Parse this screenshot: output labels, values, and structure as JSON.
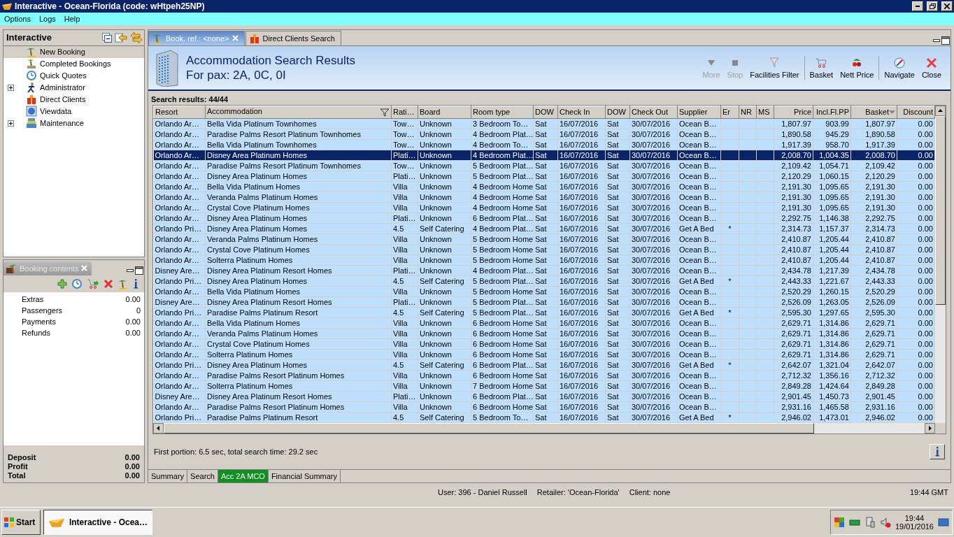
{
  "window": {
    "title": "Interactive - Ocean-Florida (code: wHtpeh25NP)"
  },
  "menu": [
    "Options",
    "Logs",
    "Help"
  ],
  "navigator": {
    "title": "Interactive",
    "items": [
      {
        "label": "New Booking",
        "selected": true,
        "kind": "leaf"
      },
      {
        "label": "Completed Bookings",
        "selected": false,
        "kind": "leaf"
      },
      {
        "label": "Quick Quotes",
        "selected": false,
        "kind": "leaf"
      },
      {
        "label": "Administrator",
        "selected": false,
        "kind": "folder",
        "expanded": false
      },
      {
        "label": "Direct Clients",
        "selected": false,
        "kind": "leaf"
      },
      {
        "label": "Viewdata",
        "selected": false,
        "kind": "leaf"
      },
      {
        "label": "Maintenance",
        "selected": false,
        "kind": "folder",
        "expanded": false
      }
    ]
  },
  "booking_contents": {
    "title": "Booking contents",
    "lines": [
      {
        "label": "Extras",
        "value": "0.00"
      },
      {
        "label": "Passengers",
        "value": "0"
      },
      {
        "label": "Payments",
        "value": "0.00"
      },
      {
        "label": "Refunds",
        "value": "0.00"
      }
    ],
    "totals": [
      {
        "label": "Deposit",
        "value": "0.00"
      },
      {
        "label": "Profit",
        "value": "0.00"
      },
      {
        "label": "Total",
        "value": "0.00"
      }
    ]
  },
  "tabs": [
    {
      "label": "Book. ref.: <none>",
      "selected": true,
      "closable": true
    },
    {
      "label": "Direct Clients Search",
      "selected": false,
      "closable": false
    }
  ],
  "header": {
    "title": "Accommodation Search Results",
    "subtitle": "For pax: 2A, 0C, 0I"
  },
  "toolbar": [
    {
      "label": "More",
      "disabled": true,
      "separator_before": false
    },
    {
      "label": "Stop",
      "disabled": true,
      "separator_before": false
    },
    {
      "label": "Facilities Filter",
      "disabled": false,
      "separator_before": false
    },
    {
      "label": "Basket",
      "disabled": false,
      "separator_before": true
    },
    {
      "label": "Nett Price",
      "disabled": false,
      "separator_before": false
    },
    {
      "label": "Navigate",
      "disabled": false,
      "separator_before": true
    },
    {
      "label": "Close",
      "disabled": false,
      "separator_before": false
    }
  ],
  "results_count": "Search results: 44/44",
  "table": {
    "columns": [
      "Resort",
      "Accommodation",
      "Rati…",
      "Board",
      "Room type",
      "DOW",
      "Check In",
      "DOW",
      "Check Out",
      "Supplier",
      "Er",
      "NR",
      "MS",
      "Price",
      "Incl.Fl.PP",
      "Basket",
      "Discount"
    ],
    "rows": [
      {
        "selected": false,
        "cells": {
          "0": "Orlando Ar…",
          "1": "Bella Vida Platinum Townhomes",
          "2": "Tow…",
          "3": "Unknown",
          "4": "3 Bedroom To…",
          "5": "Sat",
          "6": "16/07/2016",
          "7": "Sat",
          "8": "30/07/2016",
          "9": "Ocean B…",
          "13": "1,807.97",
          "14": "903.99",
          "15": "1,807.97",
          "16": "0.00"
        }
      },
      {
        "selected": false,
        "cells": {
          "0": "Orlando Ar…",
          "1": "Paradise Palms Resort Platinum Townhomes",
          "2": "Tow…",
          "3": "Unknown",
          "4": "4 Bedroom Plat…",
          "5": "Sat",
          "6": "16/07/2016",
          "7": "Sat",
          "8": "30/07/2016",
          "9": "Ocean B…",
          "13": "1,890.58",
          "14": "945.29",
          "15": "1,890.58",
          "16": "0.00"
        }
      },
      {
        "selected": false,
        "cells": {
          "0": "Orlando Ar…",
          "1": "Bella Vida Platinum Townhomes",
          "2": "Tow…",
          "3": "Unknown",
          "4": "4 Bedroom To…",
          "5": "Sat",
          "6": "16/07/2016",
          "7": "Sat",
          "8": "30/07/2016",
          "9": "Ocean B…",
          "13": "1,917.39",
          "14": "958.70",
          "15": "1,917.39",
          "16": "0.00"
        }
      },
      {
        "selected": true,
        "cells": {
          "0": "Orlando Ar…",
          "1": "Disney Area Platinum Homes",
          "2": "Plati…",
          "3": "Unknown",
          "4": "4 Bedroom Plat…",
          "5": "Sat",
          "6": "16/07/2016",
          "7": "Sat",
          "8": "30/07/2016",
          "9": "Ocean B…",
          "13": "2,008.70",
          "14": "1,004.35",
          "15": "2,008.70",
          "16": "0.00"
        }
      },
      {
        "selected": false,
        "cells": {
          "0": "Orlando Ar…",
          "1": "Paradise Palms Resort Platinum Townhomes",
          "2": "Tow…",
          "3": "Unknown",
          "4": "5 Bedroom Plat…",
          "5": "Sat",
          "6": "16/07/2016",
          "7": "Sat",
          "8": "30/07/2016",
          "9": "Ocean B…",
          "13": "2,109.42",
          "14": "1,054.71",
          "15": "2,109.42",
          "16": "0.00"
        }
      },
      {
        "selected": false,
        "cells": {
          "0": "Orlando Ar…",
          "1": "Disney Area Platinum Homes",
          "2": "Plati…",
          "3": "Unknown",
          "4": "5 Bedroom Plat…",
          "5": "Sat",
          "6": "16/07/2016",
          "7": "Sat",
          "8": "30/07/2016",
          "9": "Ocean B…",
          "13": "2,120.29",
          "14": "1,060.15",
          "15": "2,120.29",
          "16": "0.00"
        }
      },
      {
        "selected": false,
        "cells": {
          "0": "Orlando Ar…",
          "1": "Bella Vida Platinum Homes",
          "2": "Villa",
          "3": "Unknown",
          "4": "4 Bedroom Home",
          "5": "Sat",
          "6": "16/07/2016",
          "7": "Sat",
          "8": "30/07/2016",
          "9": "Ocean B…",
          "13": "2,191.30",
          "14": "1,095.65",
          "15": "2,191.30",
          "16": "0.00"
        }
      },
      {
        "selected": false,
        "cells": {
          "0": "Orlando Ar…",
          "1": "Veranda Palms Platinum Homes",
          "2": "Villa",
          "3": "Unknown",
          "4": "4 Bedroom Home",
          "5": "Sat",
          "6": "16/07/2016",
          "7": "Sat",
          "8": "30/07/2016",
          "9": "Ocean B…",
          "13": "2,191.30",
          "14": "1,095.65",
          "15": "2,191.30",
          "16": "0.00"
        }
      },
      {
        "selected": false,
        "cells": {
          "0": "Orlando Ar…",
          "1": "Crystal Cove Platinum Homes",
          "2": "Villa",
          "3": "Unknown",
          "4": "4 Bedroom Home",
          "5": "Sat",
          "6": "16/07/2016",
          "7": "Sat",
          "8": "30/07/2016",
          "9": "Ocean B…",
          "13": "2,191.30",
          "14": "1,095.65",
          "15": "2,191.30",
          "16": "0.00"
        }
      },
      {
        "selected": false,
        "cells": {
          "0": "Orlando Ar…",
          "1": "Disney Area Platinum Homes",
          "2": "Plati…",
          "3": "Unknown",
          "4": "6 Bedroom Plat…",
          "5": "Sat",
          "6": "16/07/2016",
          "7": "Sat",
          "8": "30/07/2016",
          "9": "Ocean B…",
          "13": "2,292.75",
          "14": "1,146.38",
          "15": "2,292.75",
          "16": "0.00"
        }
      },
      {
        "selected": false,
        "cells": {
          "0": "Orlando Pri…",
          "1": "Disney Area Platinum Homes",
          "2": "4.5",
          "3": "Self Catering",
          "4": "4 Bedroom Plat…",
          "5": "Sat",
          "6": "16/07/2016",
          "7": "Sat",
          "8": "30/07/2016",
          "9": "Get A Bed",
          "10": "*",
          "13": "2,314.73",
          "14": "1,157.37",
          "15": "2,314.73",
          "16": "0.00"
        }
      },
      {
        "selected": false,
        "cells": {
          "0": "Orlando Ar…",
          "1": "Veranda Palms Platinum Homes",
          "2": "Villa",
          "3": "Unknown",
          "4": "5 Bedroom Home",
          "5": "Sat",
          "6": "16/07/2016",
          "7": "Sat",
          "8": "30/07/2016",
          "9": "Ocean B…",
          "13": "2,410.87",
          "14": "1,205.44",
          "15": "2,410.87",
          "16": "0.00"
        }
      },
      {
        "selected": false,
        "cells": {
          "0": "Orlando Ar…",
          "1": "Crystal Cove Platinum Homes",
          "2": "Villa",
          "3": "Unknown",
          "4": "5 Bedroom Home",
          "5": "Sat",
          "6": "16/07/2016",
          "7": "Sat",
          "8": "30/07/2016",
          "9": "Ocean B…",
          "13": "2,410.87",
          "14": "1,205.44",
          "15": "2,410.87",
          "16": "0.00"
        }
      },
      {
        "selected": false,
        "cells": {
          "0": "Orlando Ar…",
          "1": "Solterra Platinum Homes",
          "2": "Villa",
          "3": "Unknown",
          "4": "5 Bedroom Home",
          "5": "Sat",
          "6": "16/07/2016",
          "7": "Sat",
          "8": "30/07/2016",
          "9": "Ocean B…",
          "13": "2,410.87",
          "14": "1,205.44",
          "15": "2,410.87",
          "16": "0.00"
        }
      },
      {
        "selected": false,
        "cells": {
          "0": "Disney Are…",
          "1": "Disney Area Platinum Resort Homes",
          "2": "Plati…",
          "3": "Unknown",
          "4": "4 Bedroom Plat…",
          "5": "Sat",
          "6": "16/07/2016",
          "7": "Sat",
          "8": "30/07/2016",
          "9": "Ocean B…",
          "13": "2,434.78",
          "14": "1,217.39",
          "15": "2,434.78",
          "16": "0.00"
        }
      },
      {
        "selected": false,
        "cells": {
          "0": "Orlando Pri…",
          "1": "Disney Area Platinum Homes",
          "2": "4.5",
          "3": "Self Catering",
          "4": "5 Bedroom Plat…",
          "5": "Sat",
          "6": "16/07/2016",
          "7": "Sat",
          "8": "30/07/2016",
          "9": "Get A Bed",
          "10": "*",
          "13": "2,443.33",
          "14": "1,221.67",
          "15": "2,443.33",
          "16": "0.00"
        }
      },
      {
        "selected": false,
        "cells": {
          "0": "Orlando Ar…",
          "1": "Bella Vida Platinum Homes",
          "2": "Villa",
          "3": "Unknown",
          "4": "5 Bedroom Home",
          "5": "Sat",
          "6": "16/07/2016",
          "7": "Sat",
          "8": "30/07/2016",
          "9": "Ocean B…",
          "13": "2,520.29",
          "14": "1,260.15",
          "15": "2,520.29",
          "16": "0.00"
        }
      },
      {
        "selected": false,
        "cells": {
          "0": "Disney Are…",
          "1": "Disney Area Platinum Resort Homes",
          "2": "Plati…",
          "3": "Unknown",
          "4": "5 Bedroom Plat…",
          "5": "Sat",
          "6": "16/07/2016",
          "7": "Sat",
          "8": "30/07/2016",
          "9": "Ocean B…",
          "13": "2,526.09",
          "14": "1,263.05",
          "15": "2,526.09",
          "16": "0.00"
        }
      },
      {
        "selected": false,
        "cells": {
          "0": "Orlando Pri…",
          "1": "Paradise Palms Platinum Resort",
          "2": "4.5",
          "3": "Self Catering",
          "4": "5 Bedroom Plat…",
          "5": "Sat",
          "6": "16/07/2016",
          "7": "Sat",
          "8": "30/07/2016",
          "9": "Get A Bed",
          "10": "*",
          "13": "2,595.30",
          "14": "1,297.65",
          "15": "2,595.30",
          "16": "0.00"
        }
      },
      {
        "selected": false,
        "cells": {
          "0": "Orlando Ar…",
          "1": "Bella Vida Platinum Homes",
          "2": "Villa",
          "3": "Unknown",
          "4": "6 Bedroom Home",
          "5": "Sat",
          "6": "16/07/2016",
          "7": "Sat",
          "8": "30/07/2016",
          "9": "Ocean B…",
          "13": "2,629.71",
          "14": "1,314.86",
          "15": "2,629.71",
          "16": "0.00"
        }
      },
      {
        "selected": false,
        "cells": {
          "0": "Orlando Ar…",
          "1": "Veranda Palms Platinum Homes",
          "2": "Villa",
          "3": "Unknown",
          "4": "6 Bedroom Home",
          "5": "Sat",
          "6": "16/07/2016",
          "7": "Sat",
          "8": "30/07/2016",
          "9": "Ocean B…",
          "13": "2,629.71",
          "14": "1,314.86",
          "15": "2,629.71",
          "16": "0.00"
        }
      },
      {
        "selected": false,
        "cells": {
          "0": "Orlando Ar…",
          "1": "Crystal Cove Platinum Homes",
          "2": "Villa",
          "3": "Unknown",
          "4": "6 Bedroom Home",
          "5": "Sat",
          "6": "16/07/2016",
          "7": "Sat",
          "8": "30/07/2016",
          "9": "Ocean B…",
          "13": "2,629.71",
          "14": "1,314.86",
          "15": "2,629.71",
          "16": "0.00"
        }
      },
      {
        "selected": false,
        "cells": {
          "0": "Orlando Ar…",
          "1": "Solterra Platinum Homes",
          "2": "Villa",
          "3": "Unknown",
          "4": "6 Bedroom Home",
          "5": "Sat",
          "6": "16/07/2016",
          "7": "Sat",
          "8": "30/07/2016",
          "9": "Ocean B…",
          "13": "2,629.71",
          "14": "1,314.86",
          "15": "2,629.71",
          "16": "0.00"
        }
      },
      {
        "selected": false,
        "cells": {
          "0": "Orlando Pri…",
          "1": "Disney Area Platinum Homes",
          "2": "4.5",
          "3": "Self Catering",
          "4": "6 Bedroom Plat…",
          "5": "Sat",
          "6": "16/07/2016",
          "7": "Sat",
          "8": "30/07/2016",
          "9": "Get A Bed",
          "10": "*",
          "13": "2,642.07",
          "14": "1,321.04",
          "15": "2,642.07",
          "16": "0.00"
        }
      },
      {
        "selected": false,
        "cells": {
          "0": "Orlando Ar…",
          "1": "Paradise Palms Resort Platinum Homes",
          "2": "Villa",
          "3": "Unknown",
          "4": "6 Bedroom Home",
          "5": "Sat",
          "6": "16/07/2016",
          "7": "Sat",
          "8": "30/07/2016",
          "9": "Ocean B…",
          "13": "2,712.32",
          "14": "1,356.16",
          "15": "2,712.32",
          "16": "0.00"
        }
      },
      {
        "selected": false,
        "cells": {
          "0": "Orlando Ar…",
          "1": "Solterra Platinum Homes",
          "2": "Villa",
          "3": "Unknown",
          "4": "7 Bedroom Home",
          "5": "Sat",
          "6": "16/07/2016",
          "7": "Sat",
          "8": "30/07/2016",
          "9": "Ocean B…",
          "13": "2,849.28",
          "14": "1,424.64",
          "15": "2,849.28",
          "16": "0.00"
        }
      },
      {
        "selected": false,
        "cells": {
          "0": "Disney Are…",
          "1": "Disney Area Platinum Resort Homes",
          "2": "Plati…",
          "3": "Unknown",
          "4": "6 Bedroom Plat…",
          "5": "Sat",
          "6": "16/07/2016",
          "7": "Sat",
          "8": "30/07/2016",
          "9": "Ocean B…",
          "13": "2,901.45",
          "14": "1,450.73",
          "15": "2,901.45",
          "16": "0.00"
        }
      },
      {
        "selected": false,
        "cells": {
          "0": "Orlando Ar…",
          "1": "Paradise Palms Resort Platinum Homes",
          "2": "Villa",
          "3": "Unknown",
          "4": "6 Bedroom Home",
          "5": "Sat",
          "6": "16/07/2016",
          "7": "Sat",
          "8": "30/07/2016",
          "9": "Ocean B…",
          "13": "2,931.16",
          "14": "1,465.58",
          "15": "2,931.16",
          "16": "0.00"
        }
      },
      {
        "selected": false,
        "cells": {
          "0": "Orlando Pri…",
          "1": "Paradise Palms Platinum Resort",
          "2": "4.5",
          "3": "Self Catering",
          "4": "5 Bedroom To…",
          "5": "Sat",
          "6": "16/07/2016",
          "7": "Sat",
          "8": "30/07/2016",
          "9": "Get A Bed",
          "10": "*",
          "13": "2,946.02",
          "14": "1,473.01",
          "15": "2,946.02",
          "16": "0.00"
        }
      }
    ]
  },
  "search_time": "First portion: 6.5 sec, total search time: 29.2 sec",
  "bottom_tabs": [
    {
      "label": "Summary",
      "selected": false
    },
    {
      "label": "Search",
      "selected": false
    },
    {
      "label": "Acc 2A MCO",
      "selected": true
    },
    {
      "label": "Financial Summary",
      "selected": false
    }
  ],
  "status_bar": {
    "user": "User: 396 - Daniel Russell",
    "retailer": "Retailer: 'Ocean-Florida'",
    "client": "Client: none",
    "time": "19:44 GMT"
  },
  "taskbar": {
    "start": "Start",
    "task": "Interactive - Ocea…",
    "clock_time": "19:44",
    "clock_date": "19/01/2016"
  }
}
